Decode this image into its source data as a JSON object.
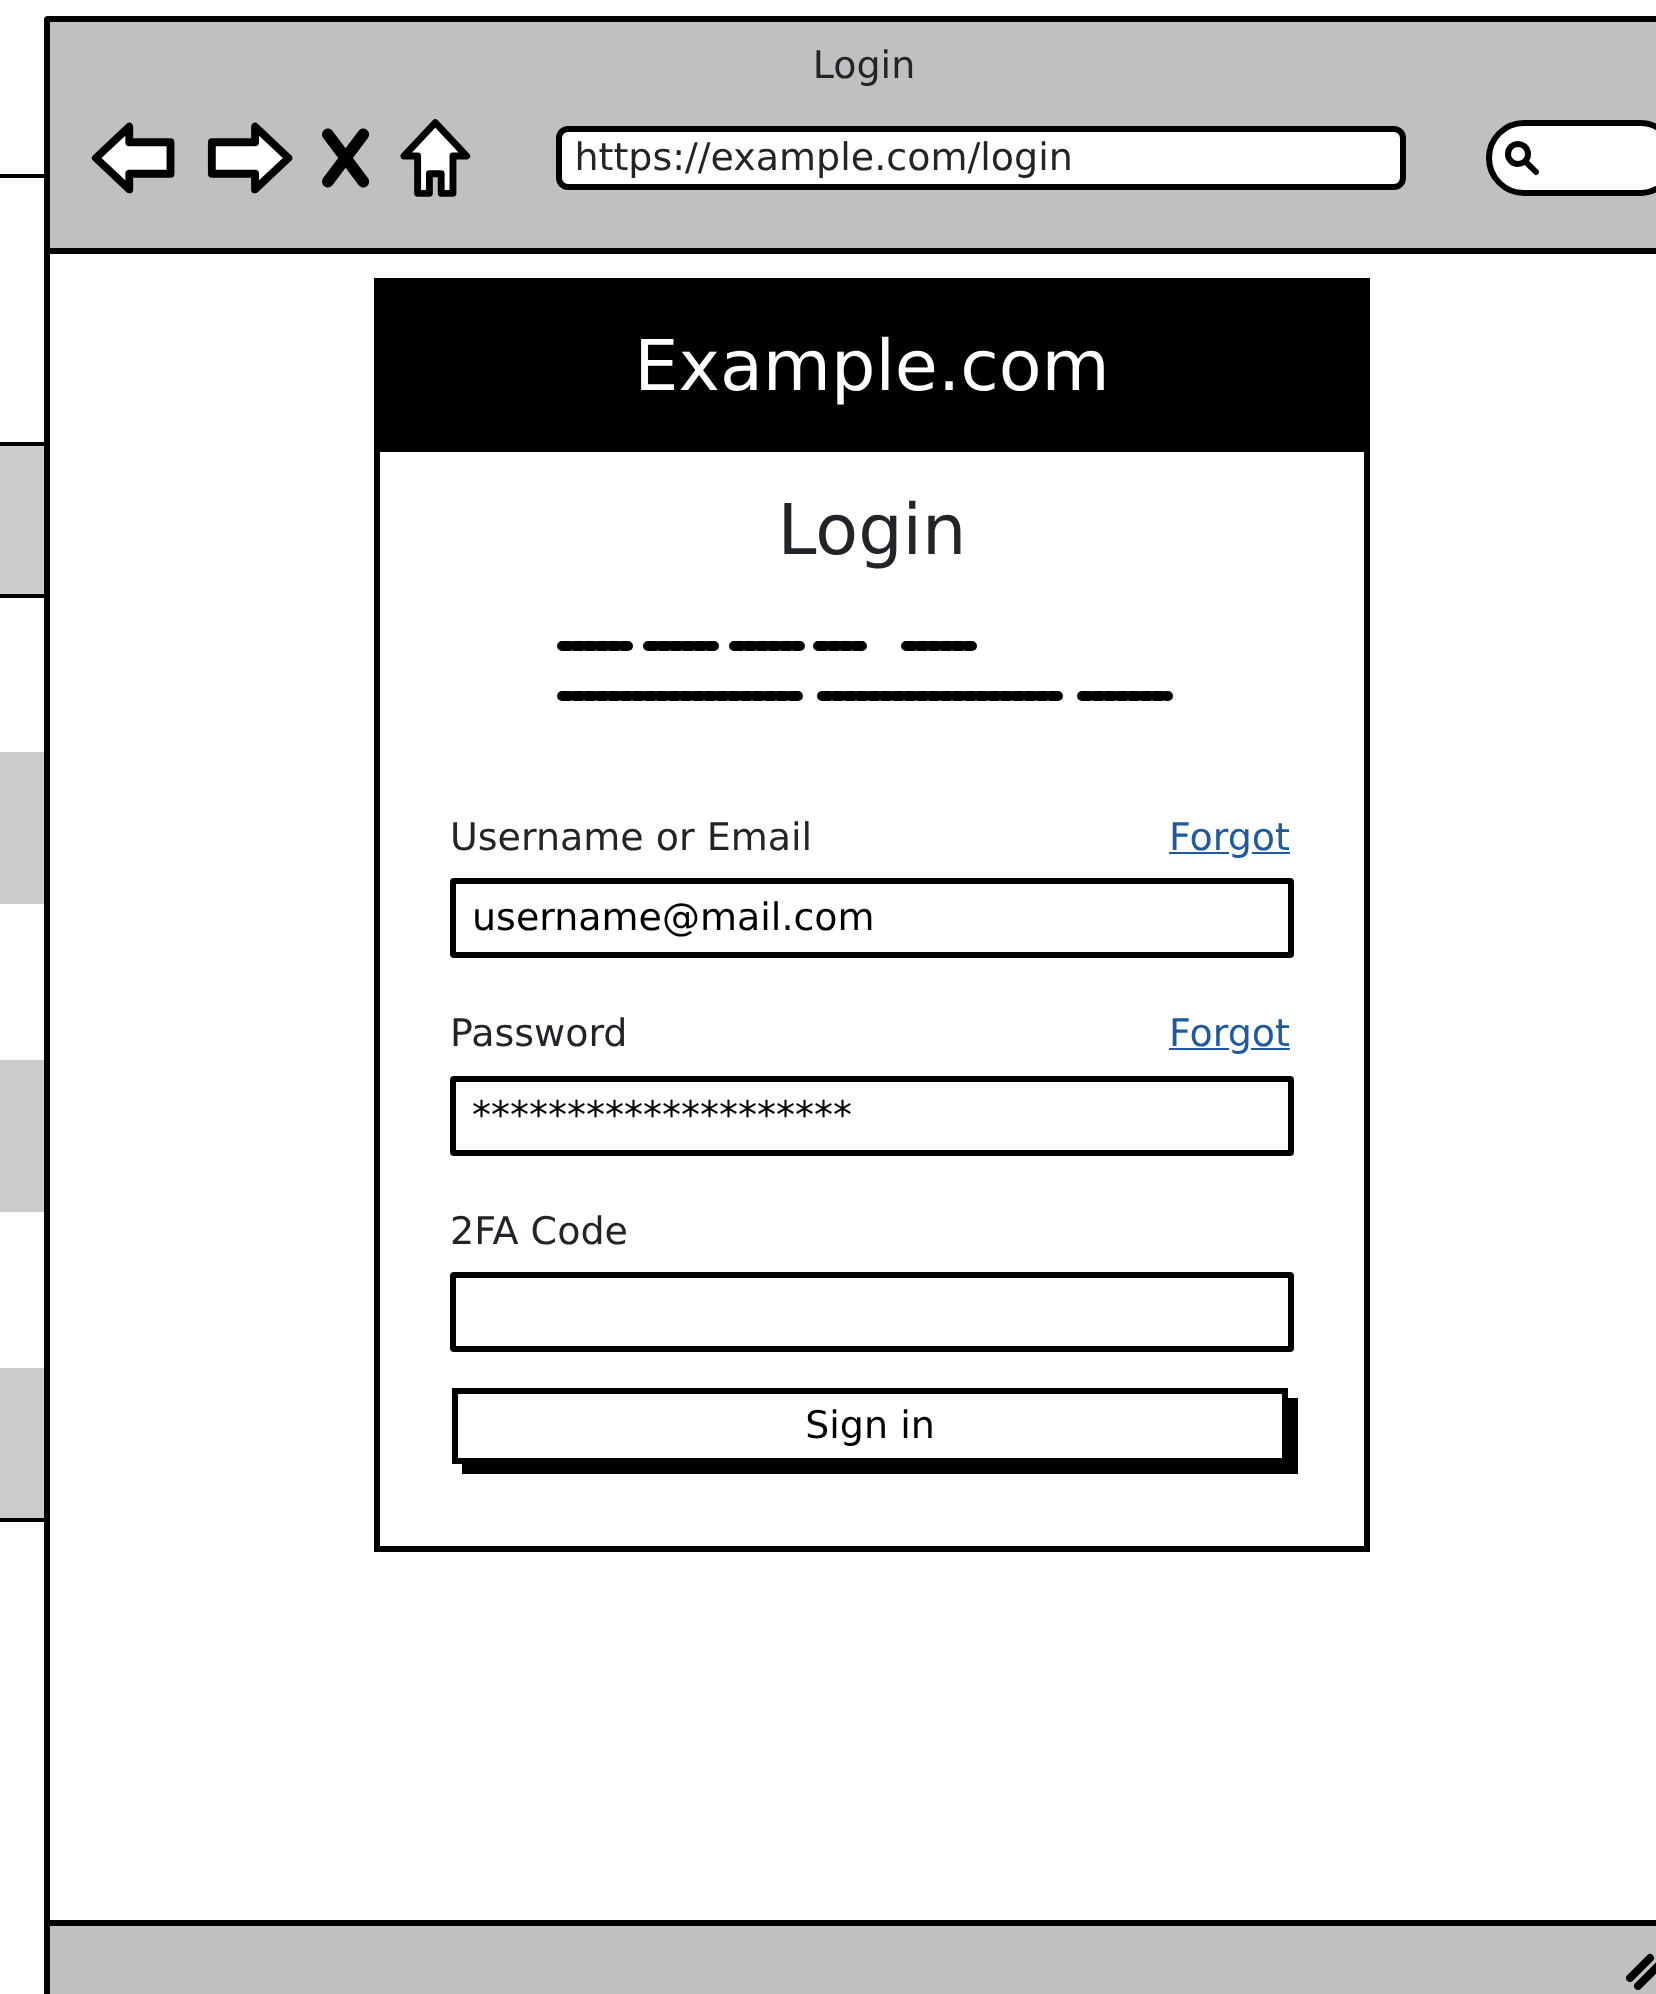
{
  "window": {
    "title": "Login",
    "url": "https://example.com/login"
  },
  "card": {
    "header": "Example.com",
    "heading": "Login"
  },
  "fields": [
    {
      "label": "Username or Email",
      "link": "Forgot",
      "value": "username@mail.com"
    },
    {
      "label": "Password",
      "link": "Forgot",
      "value": "********************"
    },
    {
      "label": "2FA Code"
    }
  ],
  "button": "Sign in"
}
